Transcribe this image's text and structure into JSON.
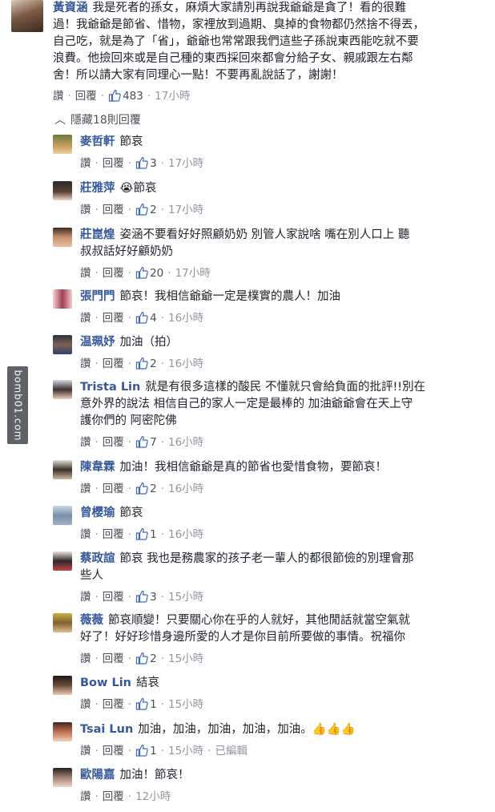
{
  "watermark": "bomb01.com",
  "top_comment": {
    "author": "黃資涵",
    "lines": [
      "我是死者的孫女，麻煩大家請別再說我爺爺是貪了！看的很難",
      "過！我爺爺是節省、惜物，家裡放到過期、臭掉的食物都仍然捨不得丟，",
      "自己吃，就是為了「省」，爺爺也常常跟我們這些子孫說東西能吃就不要",
      "浪費。他撿回來或是自己種的東西採回來都會分給子女、親戚跟左右鄰",
      "舍！所以請大家有同理心一點！不要再亂說話了，謝謝！"
    ],
    "like_label": "讚",
    "reply_label": "回覆",
    "likes": "483",
    "time": "17小時"
  },
  "hide_replies": "隱藏18則回覆",
  "replies": [
    {
      "author": "麥哲軒",
      "lines": [
        "節哀"
      ],
      "likes": "3",
      "time": "17小時"
    },
    {
      "author": "莊雅萍",
      "lines": [
        "😭節哀"
      ],
      "likes": "2",
      "time": "17小時"
    },
    {
      "author": "莊崑煌",
      "lines": [
        "姿涵不要看好好照顧奶奶 別管人家說啥 嘴在別人口上 聽",
        "叔叔話好好顧奶奶"
      ],
      "likes": "20",
      "time": "17小時"
    },
    {
      "author": "張門門",
      "lines": [
        "節哀！我相信爺爺一定是樸實的農人！加油"
      ],
      "likes": "4",
      "time": "16小時"
    },
    {
      "author": "温珮妤",
      "lines": [
        "加油（拍）"
      ],
      "likes": "2",
      "time": "16小時"
    },
    {
      "author": "Trista Lin",
      "lines": [
        "就是有很多這樣的酸民 不懂就只會給負面的批評!!別在",
        "意外界的說法 相信自己的家人一定是最棒的 加油爺爺會在天上守",
        "護你們的 阿密陀佛"
      ],
      "likes": "7",
      "time": "16小時"
    },
    {
      "author": "陳韋霖",
      "lines": [
        "加油！我相信爺爺是真的節省也愛惜食物，要節哀！"
      ],
      "likes": "2",
      "time": "16小時"
    },
    {
      "author": "曾櫻瑜",
      "lines": [
        "節哀"
      ],
      "likes": "1",
      "time": "16小時"
    },
    {
      "author": "蔡政諠",
      "lines": [
        "節哀 我也是務農家的孩子老一輩人的都很節儉的別理會那",
        "些人"
      ],
      "likes": "3",
      "time": "15小時"
    },
    {
      "author": "薇薇",
      "lines": [
        "節哀順變！只要關心你在乎的人就好，其他閒話就當空氣就",
        "好了！好好珍惜身邊所愛的人才是你目前所要做的事情。祝福你"
      ],
      "likes": "2",
      "time": "15小時"
    },
    {
      "author": "Bow Lin",
      "lines": [
        "結哀"
      ],
      "likes": "1",
      "time": "15小時"
    },
    {
      "author": "Tsai Lun",
      "lines": [
        "加油，加油，加油，加油，加油。👍👍👍"
      ],
      "likes": "1",
      "time": "15小時",
      "edited": "已編輯"
    },
    {
      "author": "歐陽嘉",
      "lines": [
        "加油！節哀！"
      ],
      "likes": null,
      "time": "12小時"
    }
  ],
  "like_label": "讚",
  "reply_label": "回覆",
  "colors": {
    "author": "#365899",
    "text": "#1d2129",
    "meta": "#90949c",
    "link": "#4b4f56"
  }
}
